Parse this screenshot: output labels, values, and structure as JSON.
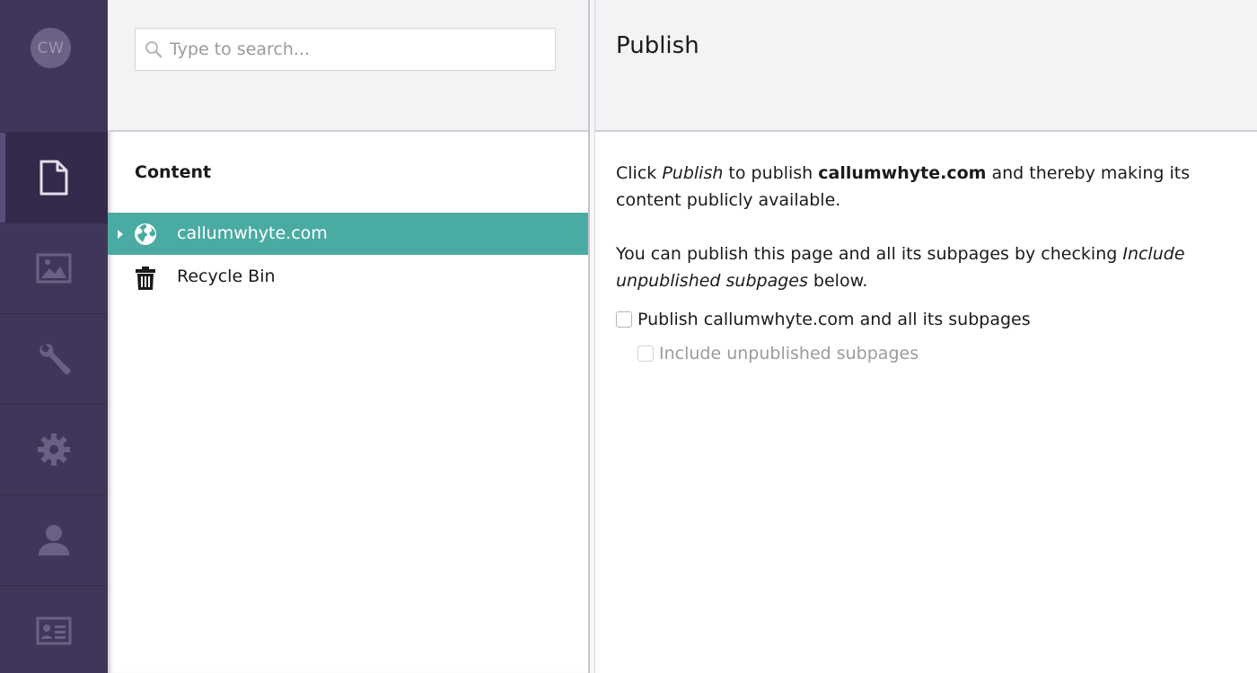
{
  "user": {
    "initials": "CW"
  },
  "colors": {
    "rail": "#413659",
    "selected": "#4aaba2"
  },
  "sections": [
    {
      "name": "content",
      "icon": "document-icon",
      "active": true
    },
    {
      "name": "media",
      "icon": "image-icon",
      "active": false
    },
    {
      "name": "settings",
      "icon": "wrench-icon",
      "active": false
    },
    {
      "name": "developer",
      "icon": "gear-icon",
      "active": false
    },
    {
      "name": "users",
      "icon": "user-icon",
      "active": false
    },
    {
      "name": "members",
      "icon": "id-card-icon",
      "active": false
    }
  ],
  "search": {
    "placeholder": "Type to search..."
  },
  "tree": {
    "title": "Content",
    "nodes": [
      {
        "label": "callumwhyte.com",
        "icon": "globe-icon",
        "selected": true,
        "expandable": true
      },
      {
        "label": "Recycle Bin",
        "icon": "trash-icon",
        "selected": false,
        "expandable": false
      }
    ]
  },
  "dialog": {
    "title": "Publish",
    "para1_prefix": "Click ",
    "para1_em": "Publish",
    "para1_mid": " to publish ",
    "para1_strong": "callumwhyte.com",
    "para1_suffix": " and thereby making its content publicly available.",
    "para2_prefix": "You can publish this page and all its subpages by checking ",
    "para2_em": "Include unpublished subpages",
    "para2_suffix": " below.",
    "option_publish_all": "Publish callumwhyte.com and all its subpages",
    "option_include_unpublished": "Include unpublished subpages"
  }
}
